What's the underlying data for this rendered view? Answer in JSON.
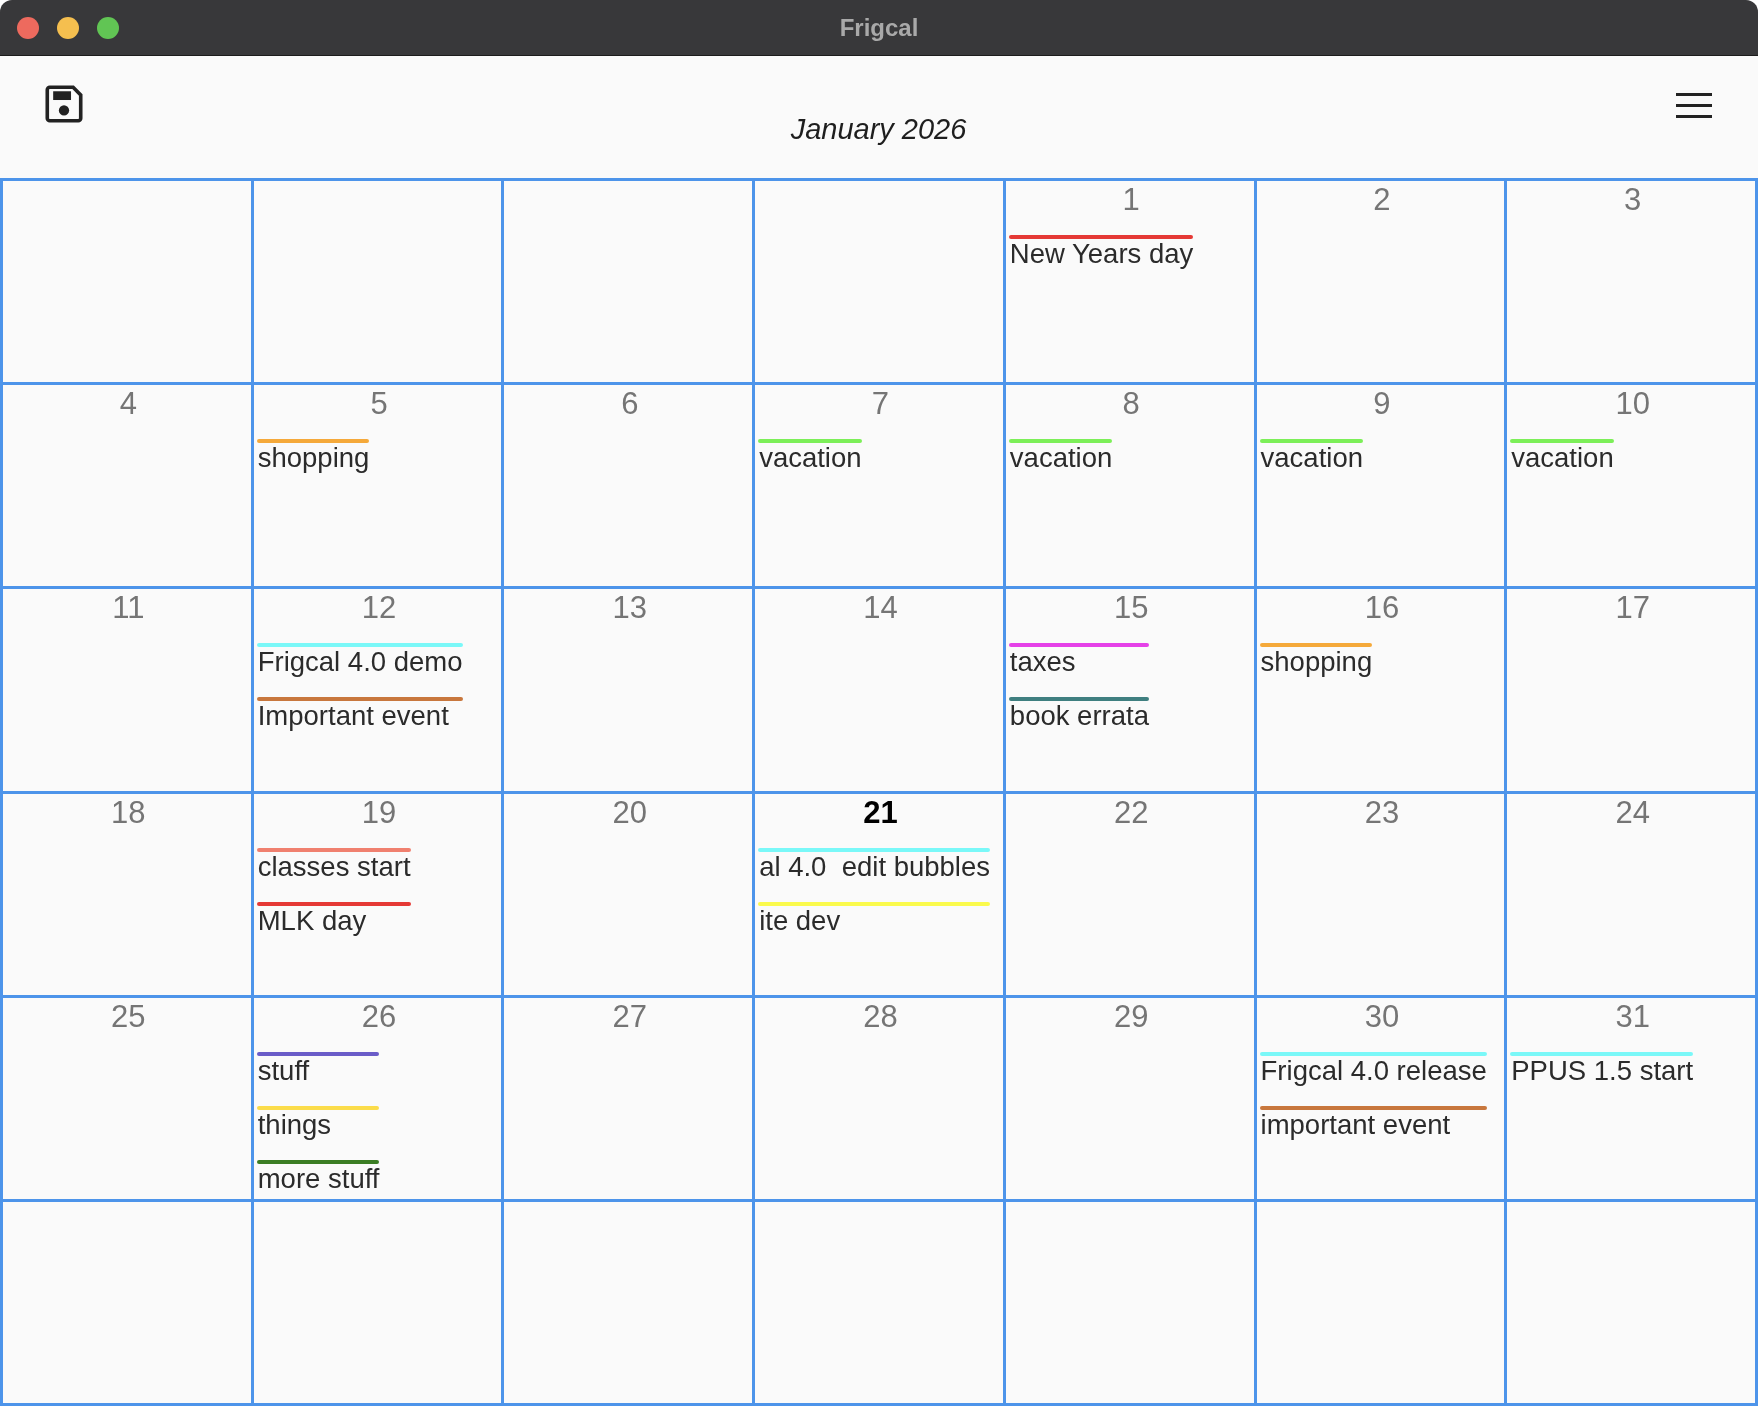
{
  "window": {
    "title": "Frigcal"
  },
  "header": {
    "month": "January 2026"
  },
  "weeks": [
    [
      {
        "kind": "blank"
      },
      {
        "kind": "blank"
      },
      {
        "kind": "blank"
      },
      {
        "kind": "blank"
      },
      {
        "kind": "day",
        "day": "1",
        "today": false,
        "events": [
          {
            "label": "New Years day",
            "color": "#e53935"
          }
        ]
      },
      {
        "kind": "day",
        "day": "2",
        "today": false
      },
      {
        "kind": "day",
        "day": "3",
        "today": false
      }
    ],
    [
      {
        "kind": "day",
        "day": "4",
        "today": false
      },
      {
        "kind": "day",
        "day": "5",
        "today": false,
        "events": [
          {
            "label": "shopping",
            "color": "#f5a93a"
          }
        ]
      },
      {
        "kind": "day",
        "day": "6",
        "today": false
      },
      {
        "kind": "day",
        "day": "7",
        "today": false,
        "events": [
          {
            "label": "vacation",
            "color": "#7cef58"
          }
        ]
      },
      {
        "kind": "day",
        "day": "8",
        "today": false,
        "events": [
          {
            "label": "vacation",
            "color": "#7cef58"
          }
        ]
      },
      {
        "kind": "day",
        "day": "9",
        "today": false,
        "events": [
          {
            "label": "vacation",
            "color": "#7cef58"
          }
        ]
      },
      {
        "kind": "day",
        "day": "10",
        "today": false,
        "events": [
          {
            "label": "vacation",
            "color": "#7cef58"
          }
        ]
      }
    ],
    [
      {
        "kind": "day",
        "day": "11",
        "today": false
      },
      {
        "kind": "day",
        "day": "12",
        "today": false,
        "events": [
          {
            "label": "Frigcal 4.0 demo",
            "color": "#7af8f8"
          },
          {
            "label": "Important event",
            "color": "#c8773d"
          }
        ]
      },
      {
        "kind": "day",
        "day": "13",
        "today": false
      },
      {
        "kind": "day",
        "day": "14",
        "today": false
      },
      {
        "kind": "day",
        "day": "15",
        "today": false,
        "events": [
          {
            "label": "taxes",
            "color": "#e541e8"
          },
          {
            "label": "book errata",
            "color": "#3f7f80"
          }
        ]
      },
      {
        "kind": "day",
        "day": "16",
        "today": false,
        "events": [
          {
            "label": "shopping",
            "color": "#f5a93a"
          }
        ]
      },
      {
        "kind": "day",
        "day": "17",
        "today": false
      }
    ],
    [
      {
        "kind": "day",
        "day": "18",
        "today": false
      },
      {
        "kind": "day",
        "day": "19",
        "today": false,
        "events": [
          {
            "label": "classes start",
            "color": "#f0806f"
          },
          {
            "label": "MLK day",
            "color": "#e53935"
          }
        ]
      },
      {
        "kind": "day",
        "day": "20",
        "today": false
      },
      {
        "kind": "day",
        "day": "21",
        "today": true,
        "events": [
          {
            "label": "al 4.0  edit bubbles",
            "color": "#7af8f8"
          },
          {
            "label": "ite dev",
            "color": "#fafa4c"
          }
        ]
      },
      {
        "kind": "day",
        "day": "22",
        "today": false
      },
      {
        "kind": "day",
        "day": "23",
        "today": false
      },
      {
        "kind": "day",
        "day": "24",
        "today": false
      }
    ],
    [
      {
        "kind": "day",
        "day": "25",
        "today": false
      },
      {
        "kind": "day",
        "day": "26",
        "today": false,
        "events": [
          {
            "label": "stuff",
            "color": "#6a5cc8"
          },
          {
            "label": "things",
            "color": "#fbdc4a"
          },
          {
            "label": "more stuff",
            "color": "#3b7d24"
          }
        ]
      },
      {
        "kind": "day",
        "day": "27",
        "today": false
      },
      {
        "kind": "day",
        "day": "28",
        "today": false
      },
      {
        "kind": "day",
        "day": "29",
        "today": false
      },
      {
        "kind": "day",
        "day": "30",
        "today": false,
        "events": [
          {
            "label": "Frigcal 4.0 release",
            "color": "#7af8f8"
          },
          {
            "label": "important event",
            "color": "#c8773d"
          }
        ]
      },
      {
        "kind": "day",
        "day": "31",
        "today": false,
        "events": [
          {
            "label": "PPUS 1.5 start",
            "color": "#7af8f8"
          }
        ]
      }
    ],
    [
      {
        "kind": "blank"
      },
      {
        "kind": "blank"
      },
      {
        "kind": "blank"
      },
      {
        "kind": "blank"
      },
      {
        "kind": "blank"
      },
      {
        "kind": "blank"
      },
      {
        "kind": "blank"
      }
    ]
  ]
}
